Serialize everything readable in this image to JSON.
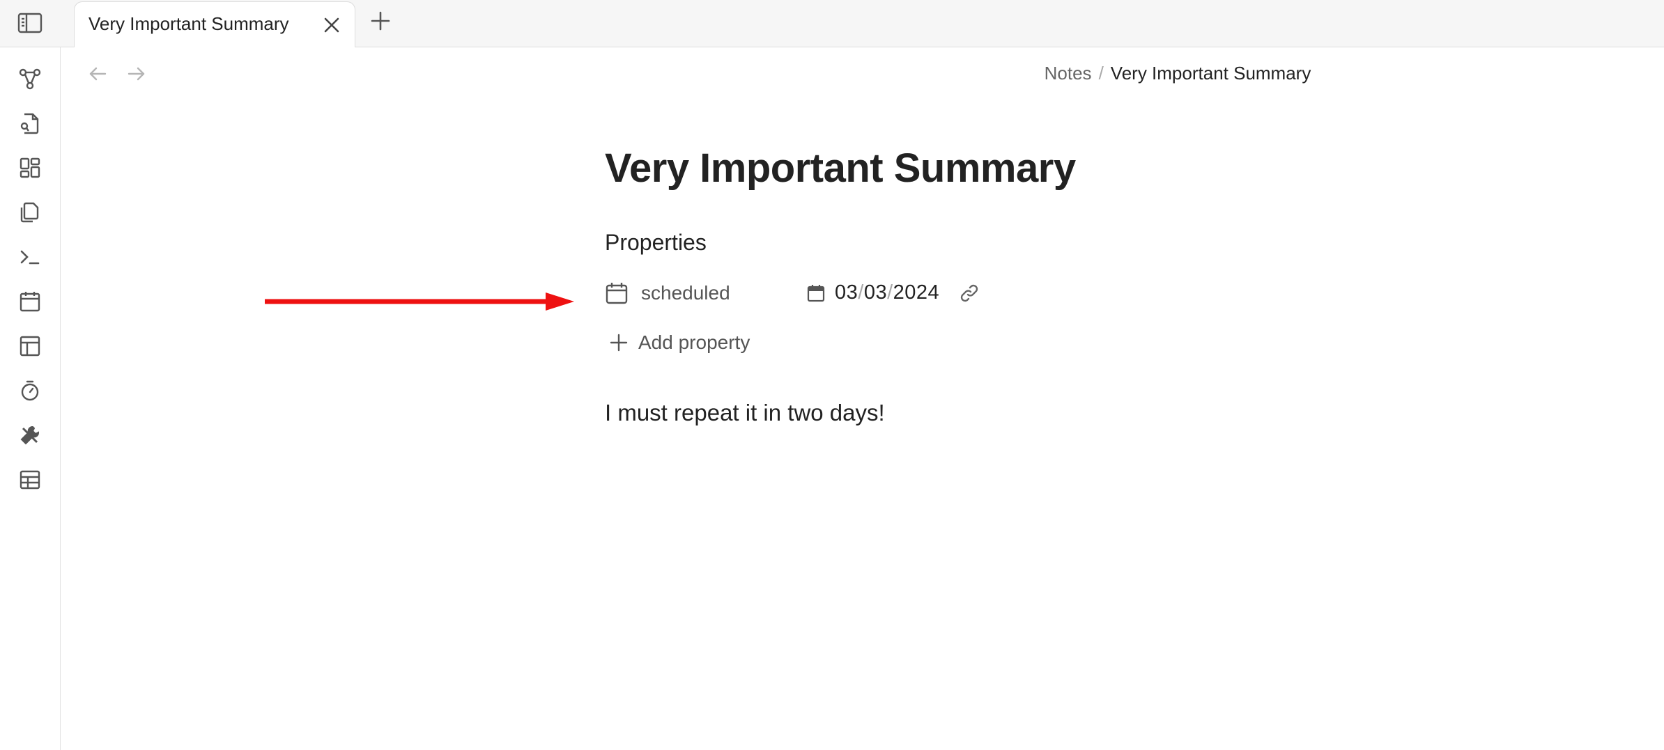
{
  "tab": {
    "title": "Very Important Summary"
  },
  "breadcrumb": {
    "parent": "Notes",
    "separator": "/",
    "current": "Very Important Summary"
  },
  "document": {
    "title": "Very Important Summary",
    "properties_heading": "Properties",
    "properties": [
      {
        "icon": "calendar-icon",
        "key": "scheduled",
        "value": {
          "month": "03",
          "day": "03",
          "year": "2024",
          "separator": "/"
        }
      }
    ],
    "add_property_label": "Add property",
    "body": "I must repeat it in two days!"
  },
  "ribbon": {
    "icons": [
      "graph-icon",
      "search-file-icon",
      "dashboard-icon",
      "files-icon",
      "terminal-icon",
      "calendar-icon",
      "layout-icon",
      "timer-icon",
      "tools-icon",
      "table-icon"
    ]
  },
  "colors": {
    "annotation_arrow": "#ee1111",
    "accent_text": "#222222",
    "muted_text": "#555555"
  }
}
